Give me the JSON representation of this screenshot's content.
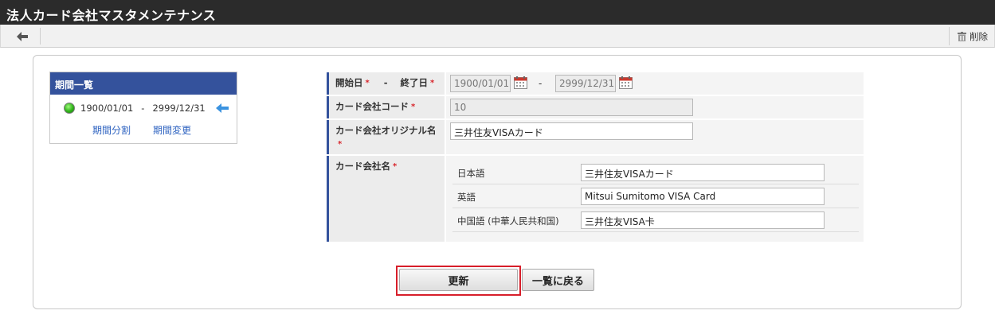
{
  "window": {
    "title": "法人カード会社マスタメンテナンス"
  },
  "toolbar": {
    "back_icon": "left-arrow-icon",
    "delete_label": "削除",
    "delete_icon": "trash-icon"
  },
  "periods": {
    "header": "期間一覧",
    "current": {
      "start": "1900/01/01",
      "sep": "-",
      "end": "2999/12/31"
    },
    "links": {
      "split": "期間分割",
      "change": "期間変更"
    }
  },
  "form": {
    "start_label": "開始日",
    "dash_label": "-",
    "end_label": "終了日",
    "required_mark": "*",
    "start_value": "1900/01/01",
    "range_sep": "-",
    "end_value": "2999/12/31",
    "code_label": "カード会社コード",
    "code_value": "10",
    "original_label": "カード会社オリジナル名",
    "original_value": "三井住友VISAカード",
    "name_label": "カード会社名",
    "names": [
      {
        "lang": "日本語",
        "value": "三井住友VISAカード"
      },
      {
        "lang": "英語",
        "value": "Mitsui Sumitomo VISA Card"
      },
      {
        "lang": "中国語 (中華人民共和国)",
        "value": "三井住友VISA卡"
      }
    ]
  },
  "actions": {
    "update_label": "更新",
    "back_label": "一覧に戻る"
  },
  "colors": {
    "accent": "#34529c",
    "required": "#d8262c",
    "link": "#2d62c0",
    "highlight": "#d71e2a"
  }
}
